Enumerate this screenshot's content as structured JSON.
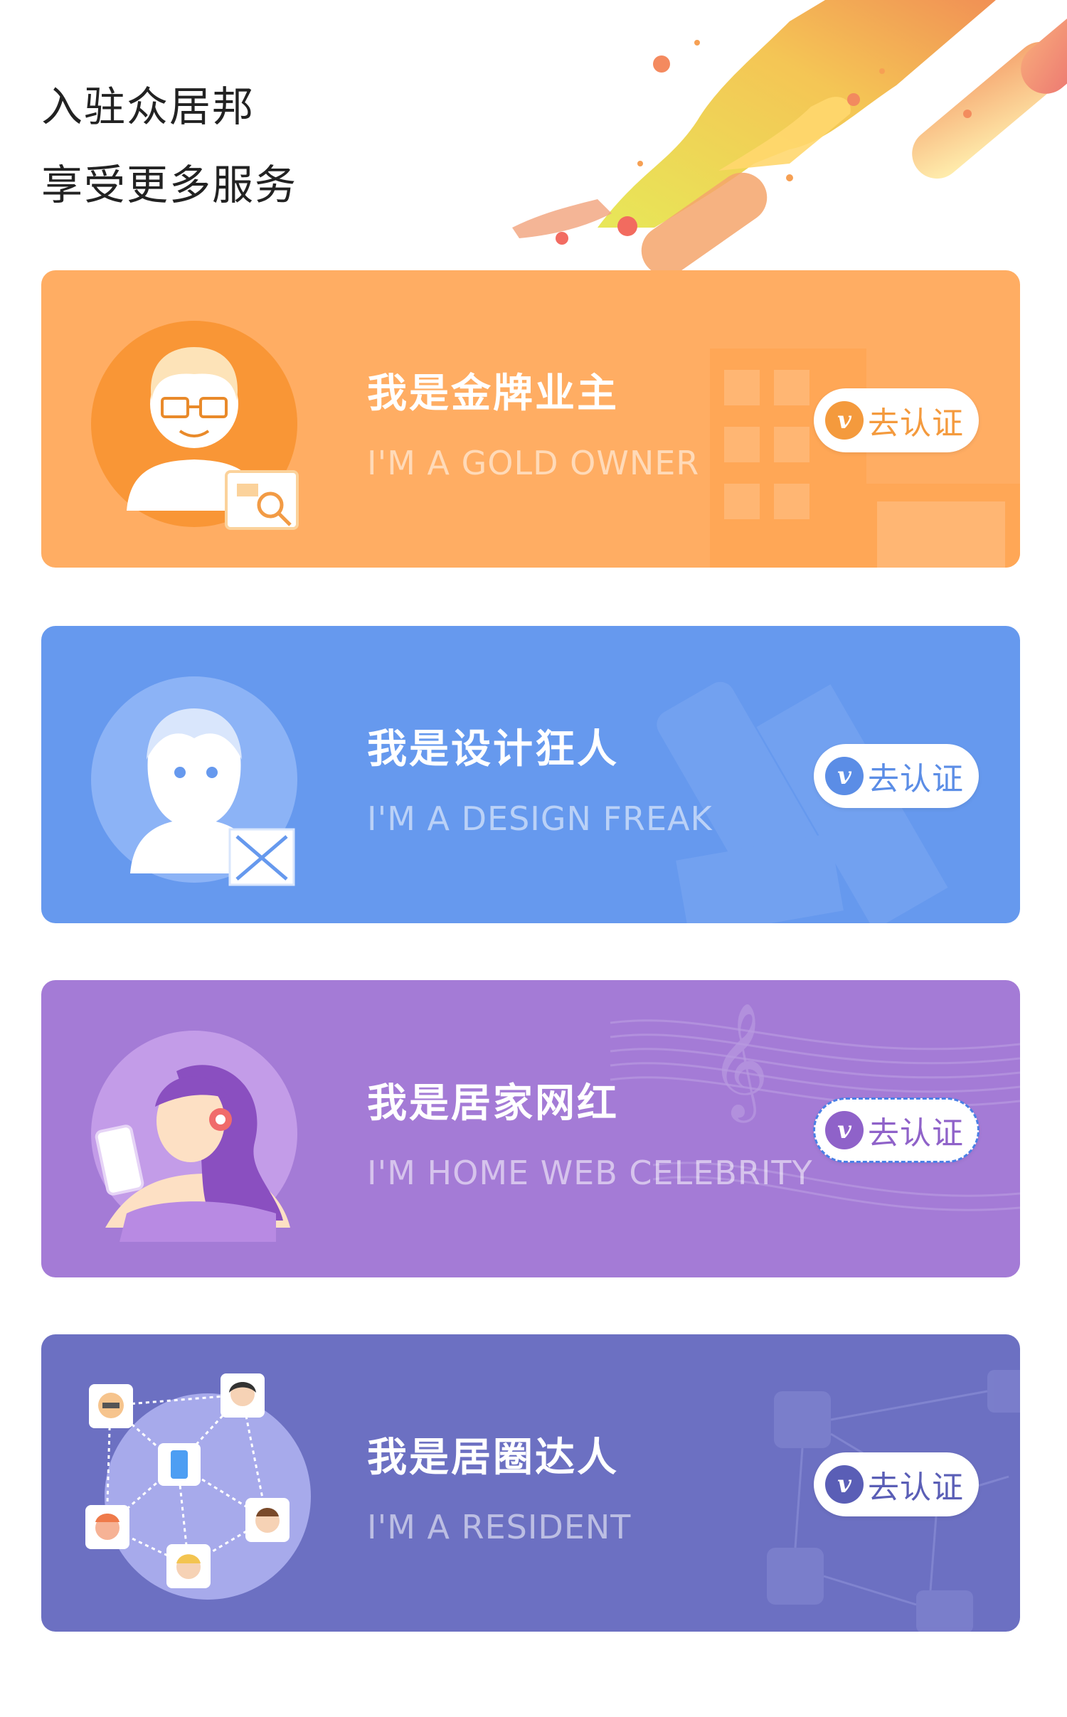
{
  "header": {
    "line1": "入驻众居邦",
    "line2": "享受更多服务"
  },
  "cards": [
    {
      "title": "我是金牌业主",
      "subtitle": "I'M A GOLD OWNER",
      "button": "去认证",
      "button_icon": "v-badge-icon",
      "color": "#ffad63",
      "accent": "#f49a3d"
    },
    {
      "title": "我是设计狂人",
      "subtitle": "I'M A DESIGN FREAK",
      "button": "去认证",
      "button_icon": "v-badge-icon",
      "color": "#6699ee",
      "accent": "#5b8de6"
    },
    {
      "title": "我是居家网红",
      "subtitle": "I'M HOME WEB CELEBRITY",
      "button": "去认证",
      "button_icon": "v-badge-icon",
      "color": "#a47bd6",
      "accent": "#8f62c9"
    },
    {
      "title": "我是居圈达人",
      "subtitle": "I'M A RESIDENT",
      "button": "去认证",
      "button_icon": "v-badge-icon",
      "color": "#6c70c2",
      "accent": "#5a5eb6"
    }
  ]
}
